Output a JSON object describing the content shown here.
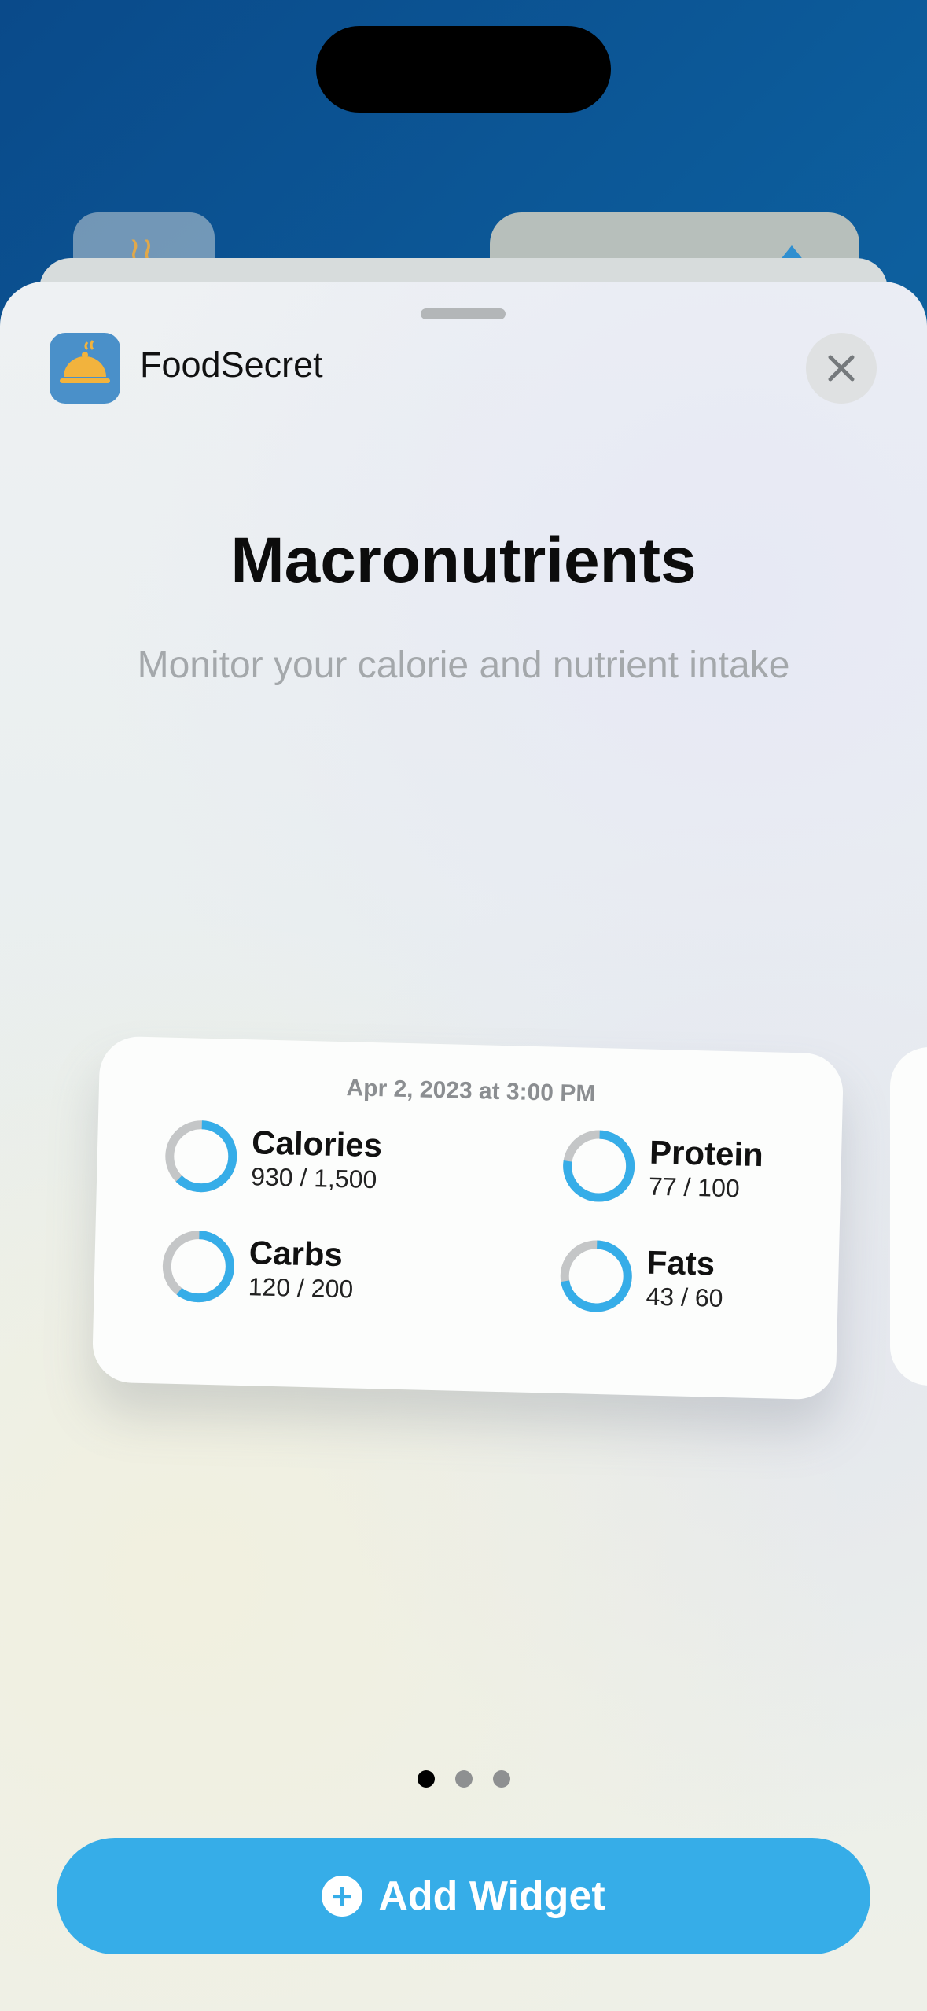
{
  "app": {
    "name": "FoodSecret",
    "icon": "serving-cloche-icon"
  },
  "sheet": {
    "close_icon": "close-icon",
    "widget_title": "Macronutrients",
    "widget_description": "Monitor your calorie and nutrient intake"
  },
  "widget": {
    "timestamp": "Apr 2, 2023 at 3:00 PM",
    "metrics": [
      {
        "name": "Calories",
        "value_text": "930 / 1,500",
        "progress": 0.62
      },
      {
        "name": "Protein",
        "value_text": "77 / 100",
        "progress": 0.77
      },
      {
        "name": "Carbs",
        "value_text": "120 / 200",
        "progress": 0.6
      },
      {
        "name": "Fats",
        "value_text": "43 / 60",
        "progress": 0.72
      }
    ]
  },
  "pager": {
    "pages": 3,
    "active_index": 0
  },
  "add_button": {
    "label": "Add Widget",
    "icon": "plus-circle-icon"
  },
  "colors": {
    "accent": "#36ade8",
    "ring_track": "#c4c6c7",
    "app_icon_bg": "#4a90c9",
    "app_icon_fg": "#f2b33d"
  }
}
